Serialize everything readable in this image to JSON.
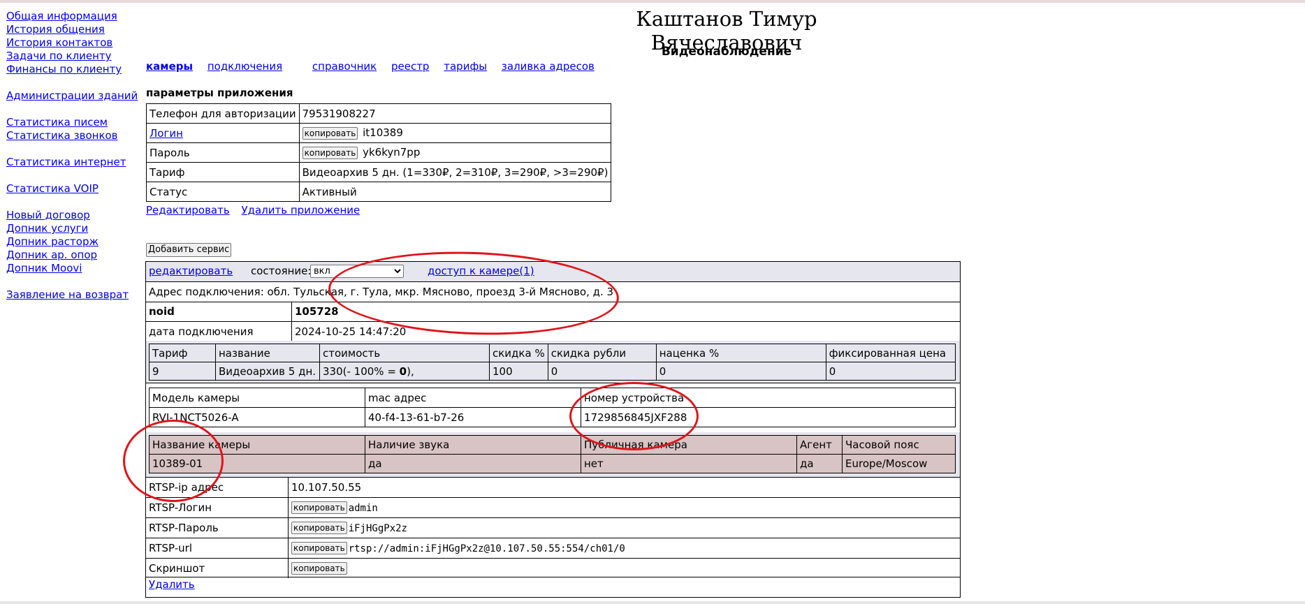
{
  "sidebar": {
    "groups": [
      [
        "Общая информация",
        "История общения",
        "История контактов",
        "Задачи по клиенту",
        "Финансы по клиенту"
      ],
      [
        "Администрации зданий"
      ],
      [
        "Статистика писем",
        "Статистика звонков"
      ],
      [
        "Статистика интернет"
      ],
      [
        "Статистика VOIP"
      ],
      [
        "Новый договор",
        "Допник услуги",
        "Допник расторж",
        "Допник ар. опор",
        "Допник Moovi"
      ],
      [
        "Заявление на возврат"
      ]
    ]
  },
  "header": {
    "title": "Каштанов Тимур Вячеславович",
    "subtitle": "Видеонаблюдение"
  },
  "tabs": [
    "камеры",
    "подключения",
    "справочник",
    "реестр",
    "тарифы",
    "заливка адресов"
  ],
  "params": {
    "caption": "параметры приложения",
    "copy_label": "копировать",
    "rows": {
      "phone": {
        "label": "Телефон для авторизации",
        "value": "79531908227"
      },
      "login": {
        "label": "Логин",
        "value": "it10389"
      },
      "password": {
        "label": "Пароль",
        "value": "yk6kyn7pp"
      },
      "tariff": {
        "label": "Тариф",
        "value": "Видеоархив 5 дн. (1=330₽, 2=310₽, 3=290₽, >3=290₽)"
      },
      "status": {
        "label": "Статус",
        "value": "Активный"
      }
    },
    "edit_link": "Редактировать",
    "delete_link": "Удалить приложение"
  },
  "add_service_label": "Добавить сервис",
  "service": {
    "edit_link": "редактировать ",
    "state_label": "состояние:",
    "state_value": "вкл",
    "camera_access_link": "доступ к камере(1)",
    "address": "Адрес подключения: обл. Тульская, г. Тула, мкр. Мясново, проезд 3-й Мясново, д. 3",
    "noid_label": "noid",
    "noid_value": "105728",
    "date_label": "дата подключения",
    "date_value": "2024-10-25 14:47:20",
    "tariff_table": {
      "headers": [
        "Тариф",
        "название",
        "стоимость",
        "скидка %",
        "скидка рубли",
        "наценка %",
        "фиксированная цена"
      ],
      "row": {
        "tariff": "9",
        "name": "Видеоархив 5 дн.",
        "cost_prefix": "330(- 100% = ",
        "cost_bold": "0",
        "cost_suffix": "),",
        "discount_pct": "100",
        "discount_rub": "0",
        "markup": "0",
        "fixed": "0"
      }
    },
    "camera_table": {
      "headers": [
        "Модель камеры",
        "mac адрес",
        "номер устройства"
      ],
      "row": [
        "RVI-1NCT5026-A",
        "40-f4-13-61-b7-26",
        "1729856845JXF288"
      ]
    },
    "camera_table2": {
      "headers": [
        "Название камеры",
        "Наличие звука",
        "Публичная камера",
        "Агент",
        "Часовой пояс"
      ],
      "row": [
        "10389-01",
        "да",
        "нет",
        "да",
        "Europe/Moscow"
      ]
    },
    "rtsp": {
      "ip_label": "RTSP-ip адрес",
      "ip_value": "10.107.50.55",
      "login_label": "RTSP-Логин",
      "login_value": "admin",
      "password_label": "RTSP-Пароль",
      "password_value": "iFjHGgPx2z",
      "url_label": "RTSP-url",
      "url_value": "rtsp://admin:iFjHGgPx2z@10.107.50.55:554/ch01/0",
      "screenshot_label": "Скриншот"
    },
    "delete_link": "Удалить"
  },
  "annotation_color": "#e0141b"
}
